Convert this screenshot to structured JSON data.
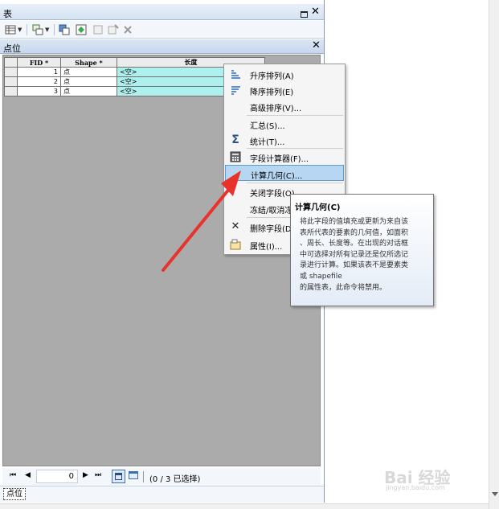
{
  "window": {
    "title": "表"
  },
  "table_tab": {
    "label": "点位"
  },
  "table": {
    "columns": [
      "FID *",
      "Shape *",
      "长度"
    ],
    "rows": [
      {
        "fid": "1",
        "shape": "点",
        "length": "<空>"
      },
      {
        "fid": "2",
        "shape": "点",
        "length": "<空>"
      },
      {
        "fid": "3",
        "shape": "点",
        "length": "<空>"
      }
    ]
  },
  "navigation": {
    "record_input": "0",
    "selection_status": "(0 / 3 已选择)"
  },
  "bottom_tab": {
    "label": "点位"
  },
  "context_menu": {
    "items": [
      {
        "label": "升序排列(A)",
        "icon": "sort-ascending-icon"
      },
      {
        "label": "降序排列(E)",
        "icon": "sort-descending-icon"
      },
      {
        "label": "高级排序(V)...",
        "icon": ""
      },
      {
        "label": "汇总(S)...",
        "icon": ""
      },
      {
        "label": "统计(T)...",
        "icon": "sigma-icon"
      },
      {
        "label": "字段计算器(F)...",
        "icon": "calculator-icon"
      },
      {
        "label": "计算几何(C)...",
        "icon": ""
      },
      {
        "label": "关闭字段(O)",
        "icon": ""
      },
      {
        "label": "冻结/取消冻",
        "icon": ""
      },
      {
        "label": "删除字段(D",
        "icon": "delete-x-icon"
      },
      {
        "label": "属性(I)...",
        "icon": "properties-icon"
      }
    ]
  },
  "tooltip": {
    "title": "计算几何(C)",
    "lines": [
      "将此字段的值填充或更新为来自该",
      "表所代表的要素的几何值，如面积",
      "、周长、长度等。在出现的对话框",
      "中可选择对所有记录还是仅所选记",
      "录进行计算。如果该表不是要素类",
      "或 shapefile",
      "的属性表，此命令将禁用。"
    ]
  },
  "watermark": {
    "main": "Bai 经验",
    "sub": "jingyan.baidu.com"
  },
  "colors": {
    "arrow": "#e8332b",
    "highlight": "#b7d6f2",
    "cell_highlight": "#aef0ee"
  }
}
